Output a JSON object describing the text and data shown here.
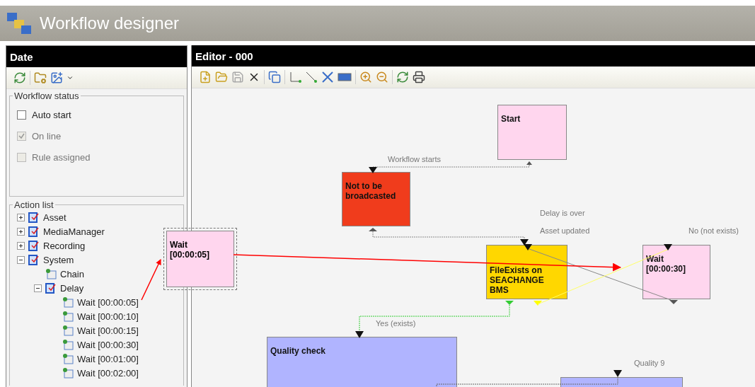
{
  "window": {
    "title": "Workflow designer"
  },
  "left_panel": {
    "title": "Date",
    "workflow_status": {
      "title": "Workflow status",
      "options": [
        {
          "label": "Auto start",
          "checked": false,
          "disabled": false
        },
        {
          "label": "On line",
          "checked": true,
          "disabled": true
        },
        {
          "label": "Rule assigned",
          "checked": false,
          "disabled": true
        }
      ]
    },
    "action_list": {
      "title": "Action list",
      "items": [
        {
          "label": "Asset",
          "expanded": false
        },
        {
          "label": "MediaManager",
          "expanded": false
        },
        {
          "label": "Recording",
          "expanded": false
        },
        {
          "label": "System",
          "expanded": true,
          "children": [
            {
              "label": "Chain"
            },
            {
              "label": "Delay",
              "expanded": true,
              "children": [
                {
                  "label": "Wait [00:00:05]"
                },
                {
                  "label": "Wait [00:00:10]"
                },
                {
                  "label": "Wait [00:00:15]"
                },
                {
                  "label": "Wait [00:00:30]"
                },
                {
                  "label": "Wait [00:01:00]"
                },
                {
                  "label": "Wait [00:02:00]"
                }
              ]
            }
          ]
        }
      ]
    }
  },
  "editor": {
    "title": "Editor - 000",
    "nodes": [
      {
        "lines": [
          "Start"
        ],
        "color": "#ffd6ee"
      },
      {
        "lines": [
          "Not to be",
          "broadcasted"
        ],
        "color": "#f03c1c"
      },
      {
        "lines": [
          "FileExists on",
          "SEACHANGE",
          "BMS"
        ],
        "color": "#ffd700"
      },
      {
        "lines": [
          "Wait",
          "[00:00:30]"
        ],
        "color": "#ffd6ee"
      },
      {
        "lines": [
          "Quality check"
        ],
        "color": "#b0b4ff"
      },
      {
        "color": "#b0b4ff"
      }
    ],
    "edge_labels": [
      "Workflow starts",
      "Delay is over",
      "Asset updated",
      "No (not exists)",
      "Yes (exists)",
      "Quality 9"
    ],
    "drag_preview": {
      "lines": [
        "Wait",
        "[00:00:05]"
      ]
    }
  }
}
